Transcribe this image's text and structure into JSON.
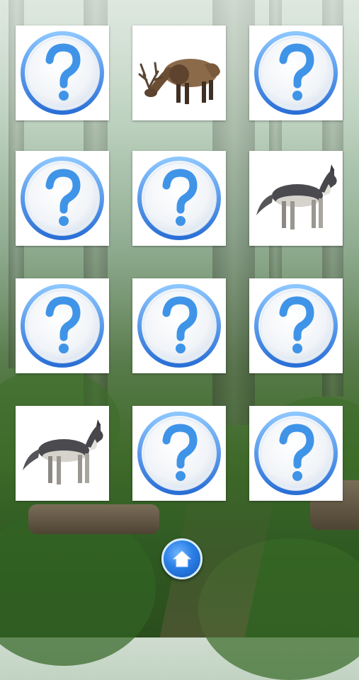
{
  "game": {
    "board_rows": 4,
    "board_cols": 3,
    "cards": [
      {
        "state": "hidden",
        "face": "question-mark"
      },
      {
        "state": "revealed",
        "face": "elk"
      },
      {
        "state": "hidden",
        "face": "question-mark"
      },
      {
        "state": "hidden",
        "face": "question-mark"
      },
      {
        "state": "hidden",
        "face": "question-mark"
      },
      {
        "state": "revealed",
        "face": "wolf"
      },
      {
        "state": "hidden",
        "face": "question-mark"
      },
      {
        "state": "hidden",
        "face": "question-mark"
      },
      {
        "state": "hidden",
        "face": "question-mark"
      },
      {
        "state": "revealed",
        "face": "wolf"
      },
      {
        "state": "hidden",
        "face": "question-mark"
      },
      {
        "state": "hidden",
        "face": "question-mark"
      }
    ],
    "card_back_symbol": "?",
    "background": "forest"
  },
  "controls": {
    "home_icon": "home-icon",
    "accent_color": "#2a7fe6"
  }
}
